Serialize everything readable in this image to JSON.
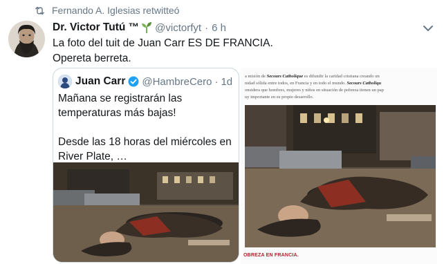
{
  "retweet": {
    "text": "Fernando A. Iglesias retwitteó",
    "icon": "retweet-icon"
  },
  "tweet": {
    "author_name": "Dr. Victor Tutú ™",
    "author_handle": "@victorfyt",
    "separator": "·",
    "time": "6 h",
    "text_line1": "La foto del tuit de Juan Carr ES DE FRANCIA.",
    "text_line2": "Opereta berreta.",
    "menu_icon": "chevron-down-icon"
  },
  "quoted_tweet": {
    "author_name": "Juan Carr",
    "author_handle": "@HambreCero",
    "separator": "·",
    "time": "1d",
    "text_para1": "Mañana se registrarán las temperaturas más bajas!",
    "text_para2": "Desde las 18 horas del miércoles en River Plate, …"
  },
  "article": {
    "line1a": "a misión de ",
    "line1b": "Secours Catholique",
    "line1c": " es difundir la caridad cristiana creando un",
    "line2a": "nidad sólida entre todos, en Francia y en todo el mundo. ",
    "line2b": "Secours Catholiqu",
    "line3": "onsidera que hombres, mujeres y niños en situación de pobreza tienen un pap",
    "line4": "uy importante en su propio desarrollo.",
    "caption": "OBREZA EN FRANCIA."
  },
  "colors": {
    "text": "#14171a",
    "muted": "#657786",
    "border": "#ccd6dd",
    "verified": "#1da1f2",
    "caption_red": "#b0202a"
  }
}
